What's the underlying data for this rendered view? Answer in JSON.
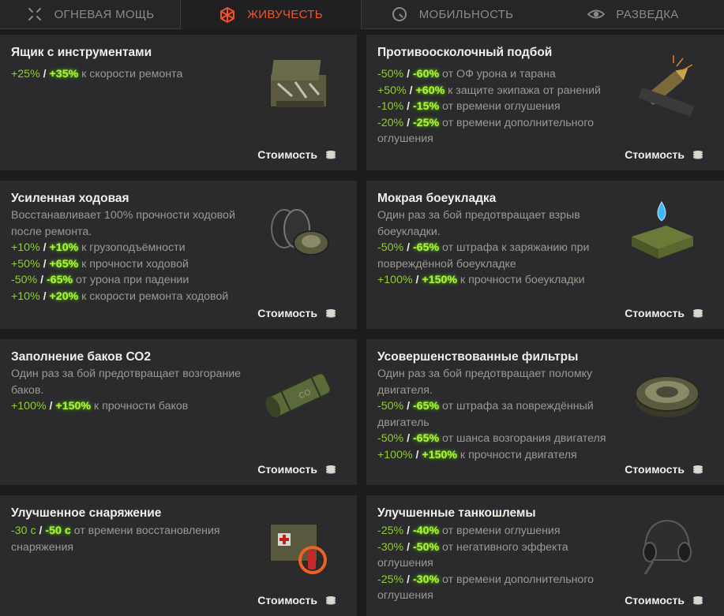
{
  "tabs": [
    {
      "label": "ОГНЕВАЯ МОЩЬ",
      "icon": "crosshair-icon"
    },
    {
      "label": "ЖИВУЧЕСТЬ",
      "icon": "cube-icon"
    },
    {
      "label": "МОБИЛЬНОСТЬ",
      "icon": "speedometer-icon"
    },
    {
      "label": "РАЗВЕДКА",
      "icon": "eye-icon"
    }
  ],
  "cost_label": "Стоимость",
  "accent_colors": {
    "active_tab": "#f25322",
    "value_green": "#8fce2d",
    "value_bright": "#b6ef3a"
  },
  "cards": [
    {
      "title": "Ящик с инструментами",
      "icon": "toolbox-icon",
      "lines": [
        [
          {
            "t": "v1",
            "s": "+25%"
          },
          {
            "t": "sep",
            "s": " / "
          },
          {
            "t": "v2",
            "s": "+35%"
          },
          {
            "t": "txt",
            "s": " к скорости ремонта"
          }
        ]
      ]
    },
    {
      "title": "Противоосколочный подбой",
      "icon": "spall-liner-icon",
      "lines": [
        [
          {
            "t": "v1",
            "s": "-50%"
          },
          {
            "t": "sep",
            "s": " / "
          },
          {
            "t": "v2",
            "s": "-60%"
          },
          {
            "t": "txt",
            "s": " от ОФ урона и тарана"
          }
        ],
        [
          {
            "t": "v1",
            "s": "+50%"
          },
          {
            "t": "sep",
            "s": " / "
          },
          {
            "t": "v2",
            "s": "+60%"
          },
          {
            "t": "txt",
            "s": " к защите экипажа от ранений"
          }
        ],
        [
          {
            "t": "v1",
            "s": "-10%"
          },
          {
            "t": "sep",
            "s": " / "
          },
          {
            "t": "v2",
            "s": "-15%"
          },
          {
            "t": "txt",
            "s": " от времени оглушения"
          }
        ],
        [
          {
            "t": "v1",
            "s": "-20%"
          },
          {
            "t": "sep",
            "s": " / "
          },
          {
            "t": "v2",
            "s": "-25%"
          },
          {
            "t": "txt",
            "s": " от времени дополнительного оглушения"
          }
        ]
      ]
    },
    {
      "title": "Усиленная ходовая",
      "icon": "tracks-icon",
      "lines": [
        [
          {
            "t": "txt",
            "s": "Восстанавливает 100% прочности ходовой после ремонта."
          }
        ],
        [
          {
            "t": "v1",
            "s": "+10%"
          },
          {
            "t": "sep",
            "s": " / "
          },
          {
            "t": "v2",
            "s": "+10%"
          },
          {
            "t": "txt",
            "s": " к грузоподъёмности"
          }
        ],
        [
          {
            "t": "v1",
            "s": "+50%"
          },
          {
            "t": "sep",
            "s": " / "
          },
          {
            "t": "v2",
            "s": "+65%"
          },
          {
            "t": "txt",
            "s": " к прочности ходовой"
          }
        ],
        [
          {
            "t": "v1",
            "s": "-50%"
          },
          {
            "t": "sep",
            "s": " / "
          },
          {
            "t": "v2",
            "s": "-65%"
          },
          {
            "t": "txt",
            "s": " от урона при падении"
          }
        ],
        [
          {
            "t": "v1",
            "s": "+10%"
          },
          {
            "t": "sep",
            "s": " / "
          },
          {
            "t": "v2",
            "s": "+20%"
          },
          {
            "t": "txt",
            "s": " к скорости ремонта ходовой"
          }
        ]
      ]
    },
    {
      "title": "Мокрая боеукладка",
      "icon": "wet-ammo-rack-icon",
      "lines": [
        [
          {
            "t": "txt",
            "s": "Один раз за бой предотвращает взрыв боеукладки."
          }
        ],
        [
          {
            "t": "v1",
            "s": "-50%"
          },
          {
            "t": "sep",
            "s": " / "
          },
          {
            "t": "v2",
            "s": "-65%"
          },
          {
            "t": "txt",
            "s": " от штрафа к заряжанию при повреждённой боеукладке"
          }
        ],
        [
          {
            "t": "v1",
            "s": "+100%"
          },
          {
            "t": "sep",
            "s": " / "
          },
          {
            "t": "v2",
            "s": "+150%"
          },
          {
            "t": "txt",
            "s": " к прочности боеукладки"
          }
        ]
      ]
    },
    {
      "title": "Заполнение баков СО2",
      "icon": "co2-tank-icon",
      "lines": [
        [
          {
            "t": "txt",
            "s": "Один раз за бой предотвращает возгорание баков."
          }
        ],
        [
          {
            "t": "v1",
            "s": "+100%"
          },
          {
            "t": "sep",
            "s": " / "
          },
          {
            "t": "v2",
            "s": "+150%"
          },
          {
            "t": "txt",
            "s": " к прочности баков"
          }
        ]
      ]
    },
    {
      "title": "Усовершенствованные фильтры",
      "icon": "air-filter-icon",
      "lines": [
        [
          {
            "t": "txt",
            "s": "Один раз за бой предотвращает поломку двигателя."
          }
        ],
        [
          {
            "t": "v1",
            "s": "-50%"
          },
          {
            "t": "sep",
            "s": " / "
          },
          {
            "t": "v2",
            "s": "-65%"
          },
          {
            "t": "txt",
            "s": " от штрафа за повреждённый двигатель"
          }
        ],
        [
          {
            "t": "v1",
            "s": "-50%"
          },
          {
            "t": "sep",
            "s": " / "
          },
          {
            "t": "v2",
            "s": "-65%"
          },
          {
            "t": "txt",
            "s": " от шанса возгорания двигателя"
          }
        ],
        [
          {
            "t": "v1",
            "s": "+100%"
          },
          {
            "t": "sep",
            "s": " / "
          },
          {
            "t": "v2",
            "s": "+150%"
          },
          {
            "t": "txt",
            "s": " к прочности двигателя"
          }
        ]
      ]
    },
    {
      "title": "Улучшенное снаряжение",
      "icon": "equipment-kit-icon",
      "lines": [
        [
          {
            "t": "v1",
            "s": "-30 с"
          },
          {
            "t": "sep",
            "s": " / "
          },
          {
            "t": "v2",
            "s": "-50 с"
          },
          {
            "t": "txt",
            "s": " от времени восстановления снаряжения"
          }
        ]
      ]
    },
    {
      "title": "Улучшенные танкошлемы",
      "icon": "tank-helmet-icon",
      "lines": [
        [
          {
            "t": "v1",
            "s": "-25%"
          },
          {
            "t": "sep",
            "s": " / "
          },
          {
            "t": "v2",
            "s": "-40%"
          },
          {
            "t": "txt",
            "s": " от времени оглушения"
          }
        ],
        [
          {
            "t": "v1",
            "s": "-30%"
          },
          {
            "t": "sep",
            "s": " / "
          },
          {
            "t": "v2",
            "s": "-50%"
          },
          {
            "t": "txt",
            "s": " от негативного эффекта оглушения"
          }
        ],
        [
          {
            "t": "v1",
            "s": "-25%"
          },
          {
            "t": "sep",
            "s": " / "
          },
          {
            "t": "v2",
            "s": "-30%"
          },
          {
            "t": "txt",
            "s": " от времени дополнительного оглушения"
          }
        ]
      ]
    }
  ]
}
